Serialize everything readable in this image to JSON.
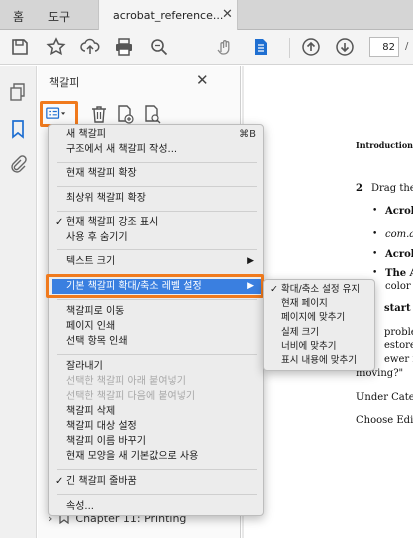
{
  "tabs": {
    "home": "홈",
    "tools": "도구",
    "document": "acrobat_reference...",
    "close": "✕"
  },
  "toolbar": {
    "icons": [
      "save-icon",
      "star-icon",
      "upload-icon",
      "print-icon",
      "search-icon",
      "hand-icon",
      "document-icon",
      "arrow-up-icon",
      "arrow-down-icon"
    ],
    "page_number": "82",
    "page_separator": "/"
  },
  "rail": {
    "icons": [
      "pages-icon",
      "bookmark-icon",
      "attachment-icon"
    ]
  },
  "panel": {
    "title": "책갈피",
    "close": "✕",
    "tool_icons": [
      "bookmark-options-icon",
      "trash-icon",
      "new-bookmark-icon",
      "bookmark-search-icon"
    ],
    "last_item": "Chapter 11: Printing"
  },
  "menu": {
    "items": [
      {
        "label": "새 책갈피",
        "shortcut": "⌘B"
      },
      {
        "label": "구조에서 새 책갈피 작성..."
      },
      {
        "label": "현재 책갈피 확장"
      },
      {
        "label": "최상위 책갈피 확장"
      },
      {
        "label": "현재 책갈피 강조 표시",
        "check": "✓"
      },
      {
        "label": "사용 후 숨기기"
      },
      {
        "label": "텍스트 크기",
        "arrow": "▶"
      },
      {
        "label": "기본 책갈피 확대/축소 레벨 설정",
        "arrow": "▶"
      },
      {
        "label": "책갈피로 이동"
      },
      {
        "label": "페이지 인쇄"
      },
      {
        "label": "선택 항목 인쇄"
      },
      {
        "label": "잘라내기"
      },
      {
        "label": "선택한 책갈피 아래 붙여넣기"
      },
      {
        "label": "선택한 책갈피 다음에 붙여넣기"
      },
      {
        "label": "책갈피 삭제"
      },
      {
        "label": "책갈피 대상 설정"
      },
      {
        "label": "책갈피 이름 바꾸기"
      },
      {
        "label": "현재 모양을 새 기본값으로 사용"
      },
      {
        "label": "긴 책갈피 줄바꿈",
        "check": "✓"
      },
      {
        "label": "속성..."
      }
    ]
  },
  "submenu": {
    "items": [
      {
        "label": "확대/축소 설정 유지",
        "check": "✓"
      },
      {
        "label": "현재 페이지"
      },
      {
        "label": "페이지에 맞추기"
      },
      {
        "label": "실제 크기"
      },
      {
        "label": "너비에 맞추기"
      },
      {
        "label": "표시 내용에 맞추기"
      }
    ]
  },
  "document": {
    "lines": [
      "Introduction to",
      "2",
      "Drag the",
      "•",
      "Acrob",
      "•",
      "com.a",
      "•",
      "Acrob",
      "•",
      "The A",
      "color s",
      "start A",
      "problem",
      "estore cu",
      "ewer ite",
      "moving?\"",
      "Under Categ",
      "Choose Edit"
    ]
  },
  "colors": {
    "highlight_outline": "#f07a1d",
    "menu_selected": "#3a7fe0"
  }
}
